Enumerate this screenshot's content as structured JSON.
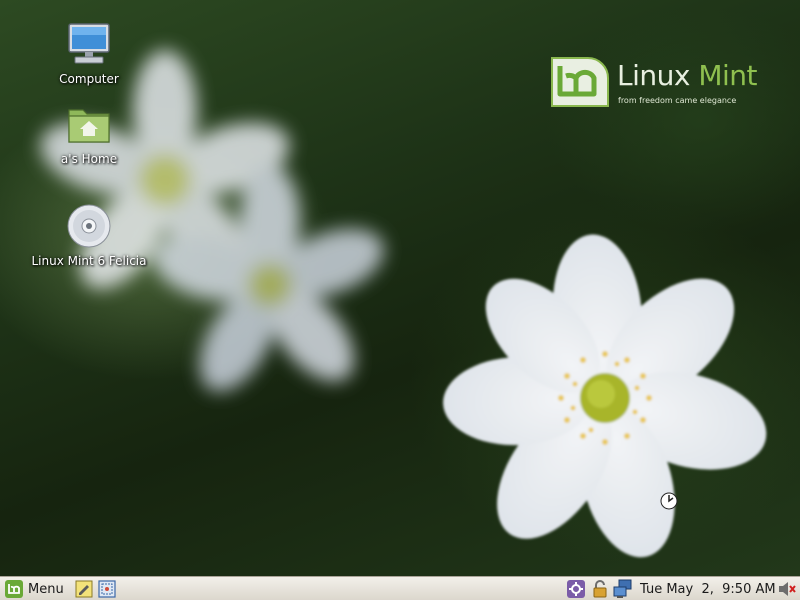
{
  "desktop": {
    "icons": [
      {
        "label": "Computer",
        "icon": "computer-icon"
      },
      {
        "label": "a's Home",
        "icon": "home-folder-icon"
      },
      {
        "label": "Linux Mint 6 Felicia",
        "icon": "cd-disc-icon"
      }
    ],
    "brand": {
      "name_part1": "Linux",
      "name_part2": "Mint",
      "tagline": "from freedom came elegance",
      "accent": "#8fc04f"
    }
  },
  "taskbar": {
    "menu_label": "Menu",
    "quick_launch": [
      {
        "icon": "text-editor-icon"
      },
      {
        "icon": "screenshot-tool-icon"
      }
    ],
    "tray": [
      {
        "icon": "update-manager-icon"
      },
      {
        "icon": "lock-icon"
      },
      {
        "icon": "network-icon"
      }
    ],
    "clock": "Tue May  2,  9:50 AM",
    "volume_icon": "speaker-muted-icon",
    "colors": {
      "panel_top": "#f3f0ea",
      "panel_bottom": "#dcd7cd",
      "mint_green": "#6aa937"
    }
  }
}
